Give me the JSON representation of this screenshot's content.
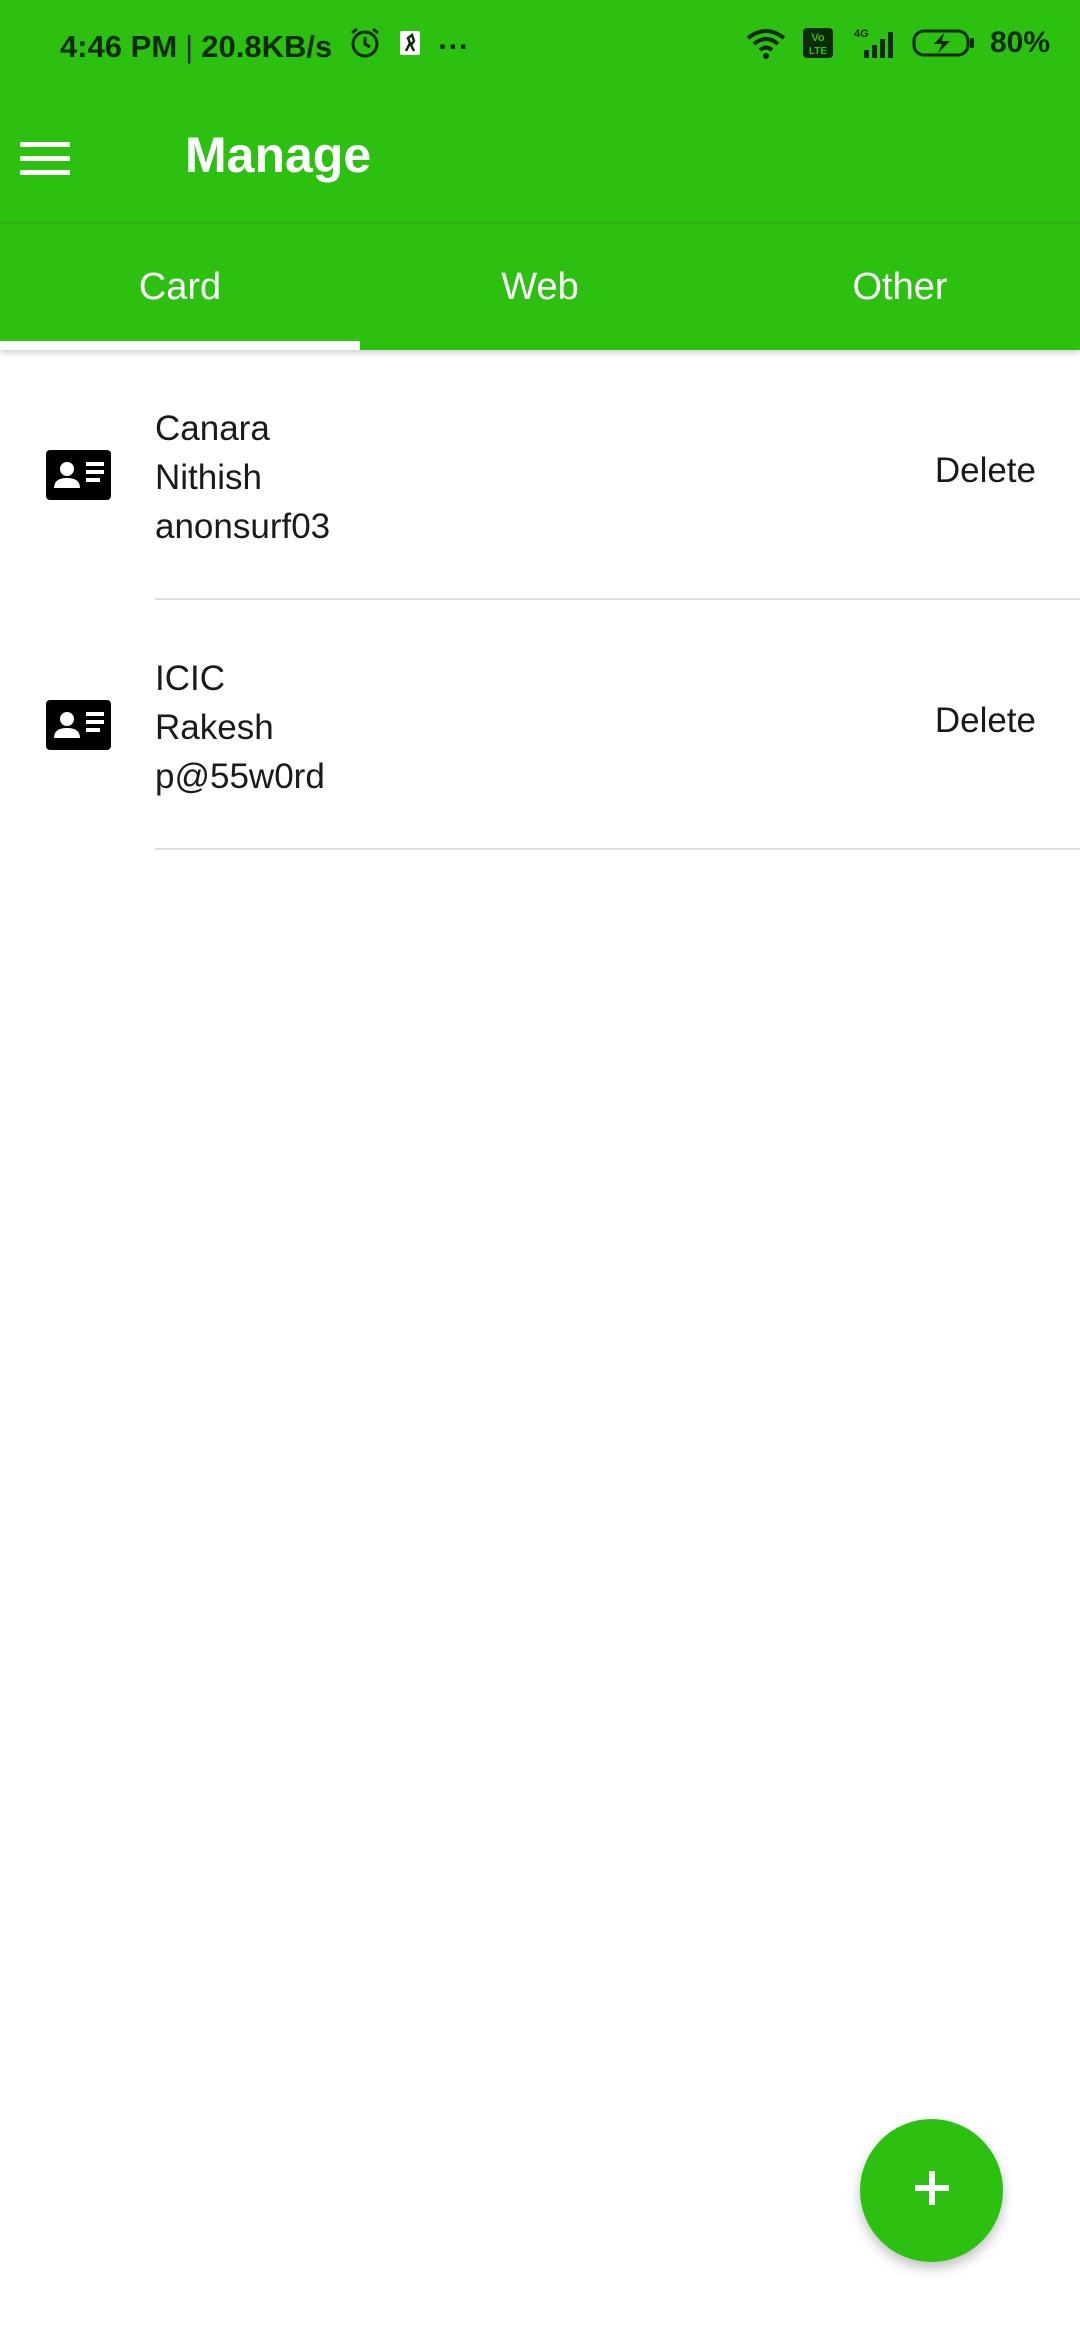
{
  "colors": {
    "primary": "#2cc011",
    "on_primary": "#ffffff",
    "text": "#1a1a1a",
    "divider": "#dedede"
  },
  "status_bar": {
    "time": "4:46 PM",
    "separator": "|",
    "speed": "20.8KB/s",
    "more": "···",
    "network_type": "4G",
    "volte": "Vo LTE",
    "battery": "80%",
    "icons": [
      "alarm-icon",
      "app-notification-icon",
      "wifi-icon",
      "volte-icon",
      "signal-icon",
      "battery-charging-icon"
    ]
  },
  "app_bar": {
    "title": "Manage",
    "menu_icon": "hamburger-menu-icon"
  },
  "tabs": [
    {
      "label": "Card",
      "active": true
    },
    {
      "label": "Web",
      "active": false
    },
    {
      "label": "Other",
      "active": false
    }
  ],
  "items": [
    {
      "icon": "contact-card-icon",
      "line1": "Canara",
      "line2": "Nithish",
      "line3": "anonsurf03",
      "action": "Delete"
    },
    {
      "icon": "contact-card-icon",
      "line1": "ICIC",
      "line2": "Rakesh",
      "line3": "p@55w0rd",
      "action": "Delete"
    }
  ],
  "fab": {
    "icon": "plus-icon",
    "label": "+"
  }
}
